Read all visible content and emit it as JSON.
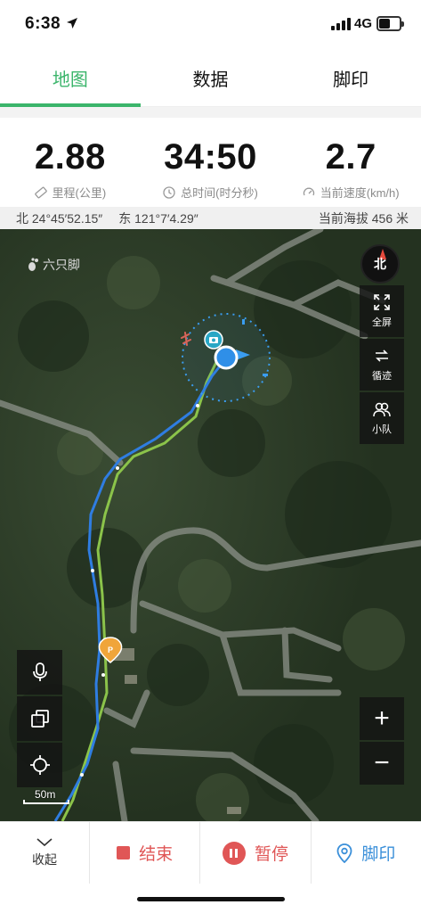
{
  "status_bar": {
    "time": "6:38",
    "network": "4G",
    "icons": [
      "location-arrow-icon",
      "signal-icon",
      "battery-icon"
    ]
  },
  "tabs": [
    {
      "label": "地图",
      "active": true
    },
    {
      "label": "数据",
      "active": false
    },
    {
      "label": "脚印",
      "active": false
    }
  ],
  "stats": [
    {
      "value": "2.88",
      "label": "里程(公里)",
      "icon": "ruler-icon"
    },
    {
      "value": "34:50",
      "label": "总时间(时分秒)",
      "icon": "clock-icon"
    },
    {
      "value": "2.7",
      "label": "当前速度(km/h)",
      "icon": "speedometer-icon"
    }
  ],
  "coords": {
    "lat": "北 24°45′52.15″",
    "lon": "东 121°7′4.29″",
    "altitude": "当前海拔 456 米"
  },
  "map": {
    "brand": "六只脚",
    "compass_label": "北",
    "side_buttons": [
      {
        "label": "全屏",
        "icon": "fullscreen-icon"
      },
      {
        "label": "循迹",
        "icon": "track-follow-icon"
      },
      {
        "label": "小队",
        "icon": "team-icon"
      }
    ],
    "left_buttons": [
      {
        "icon": "microphone-icon"
      },
      {
        "icon": "layers-icon"
      },
      {
        "icon": "locate-icon"
      }
    ],
    "zoom_in": "+",
    "zoom_out": "−",
    "scale": "50m",
    "colors": {
      "track_recorded": "#2f7de1",
      "track_planned": "#8bc34a",
      "location": "#2f8fe8"
    }
  },
  "toolbar": {
    "collapse": "收起",
    "end": "结束",
    "pause": "暂停",
    "footprint": "脚印",
    "accent_red": "#e05656",
    "accent_blue": "#3a8fd9"
  }
}
